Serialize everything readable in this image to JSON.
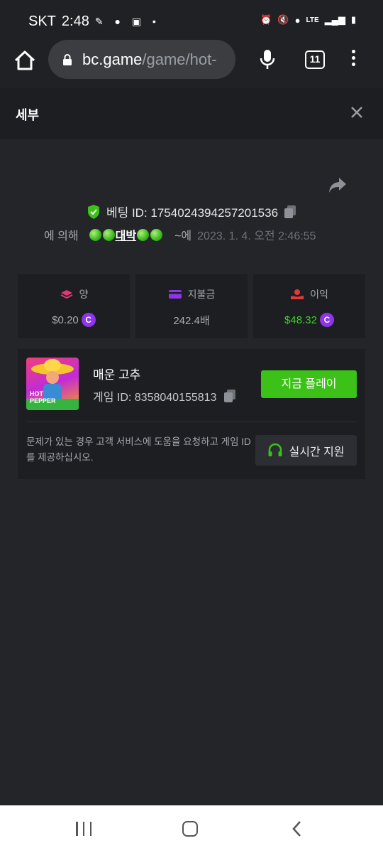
{
  "status_bar": {
    "carrier": "SKT",
    "time": "2:48",
    "network": "LTE"
  },
  "browser": {
    "url_domain": "bc.game",
    "url_path": "/game/hot-",
    "tab_count": "11"
  },
  "panel": {
    "title": "세부"
  },
  "bet": {
    "id_label": "베팅 ID: 1754024394257201536",
    "by_label": "에 의해",
    "user_name": "대박",
    "suffix": "~에",
    "timestamp": "2023. 1. 4. 오전 2:46:55"
  },
  "stats": {
    "amount_label": "양",
    "amount_value": "$0.20",
    "payout_label": "지불금",
    "payout_value": "242.4배",
    "profit_label": "이익",
    "profit_value": "$48.32",
    "coin_symbol": "C",
    "profit_color": "#3ccf27",
    "coin_color": "#8c35e9"
  },
  "game": {
    "name": "매운 고추",
    "id_label": "게임 ID: 8358040155813",
    "thumb_text_line1": "HOT",
    "thumb_text_line2": "PEPPER",
    "play_button": "지금 플레이",
    "play_button_color": "#3bc117",
    "help_text": "문제가 있는 경우 고객 서비스에 도움을 요청하고 게임 ID를 제공하십시오.",
    "support_button": "실시간 지원"
  }
}
